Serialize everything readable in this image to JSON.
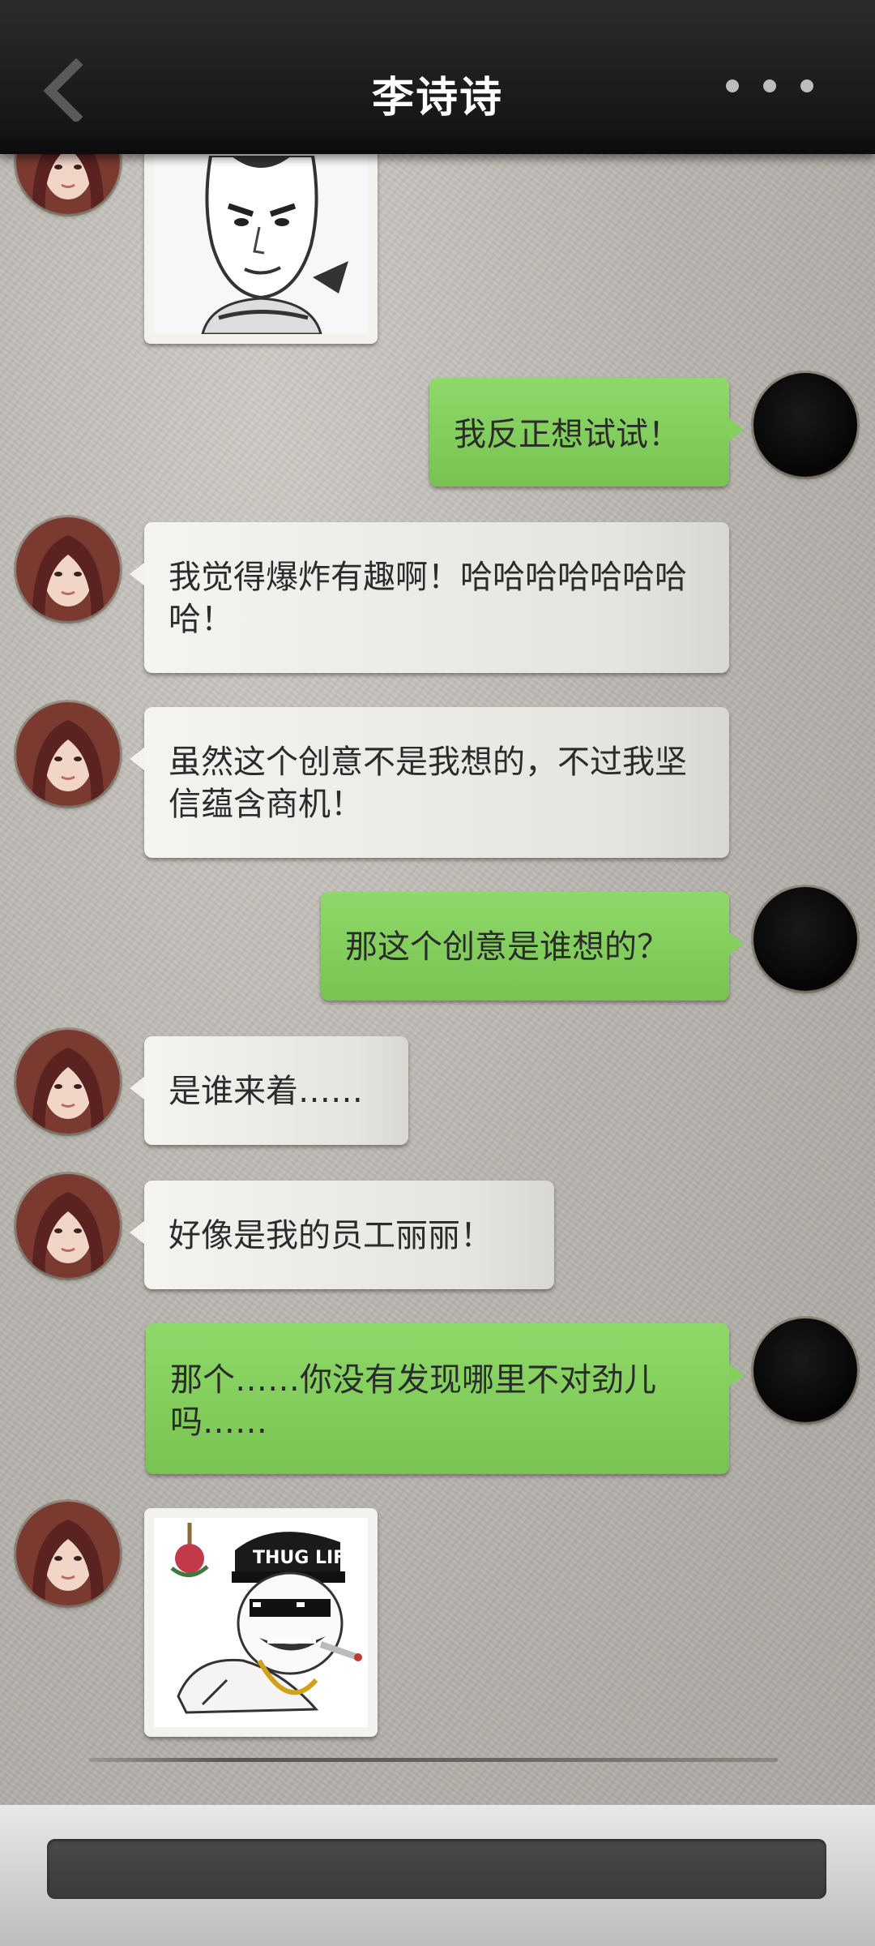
{
  "header": {
    "title": "李诗诗"
  },
  "messages": [
    {
      "side": "left",
      "type": "sticker",
      "sticker": "meme-face-arms-crossed"
    },
    {
      "side": "right",
      "type": "text",
      "text": "我反正想试试！"
    },
    {
      "side": "left",
      "type": "text",
      "text": "我觉得爆炸有趣啊！哈哈哈哈哈哈哈哈！"
    },
    {
      "side": "left",
      "type": "text",
      "text": "虽然这个创意不是我想的，不过我坚信蕴含商机！"
    },
    {
      "side": "right",
      "type": "text",
      "text": "那这个创意是谁想的？"
    },
    {
      "side": "left",
      "type": "text",
      "text": "是谁来着……"
    },
    {
      "side": "left",
      "type": "text",
      "text": "好像是我的员工丽丽！"
    },
    {
      "side": "right",
      "type": "text",
      "text": "那个……你没有发现哪里不对劲儿吗……"
    },
    {
      "side": "left",
      "type": "sticker",
      "sticker": "thug-life-meme",
      "sticker_text": "THUG LIFE"
    }
  ],
  "icons": {
    "back": "chevron-left-icon",
    "more": "more-dots-icon"
  },
  "input": {
    "placeholder": ""
  }
}
